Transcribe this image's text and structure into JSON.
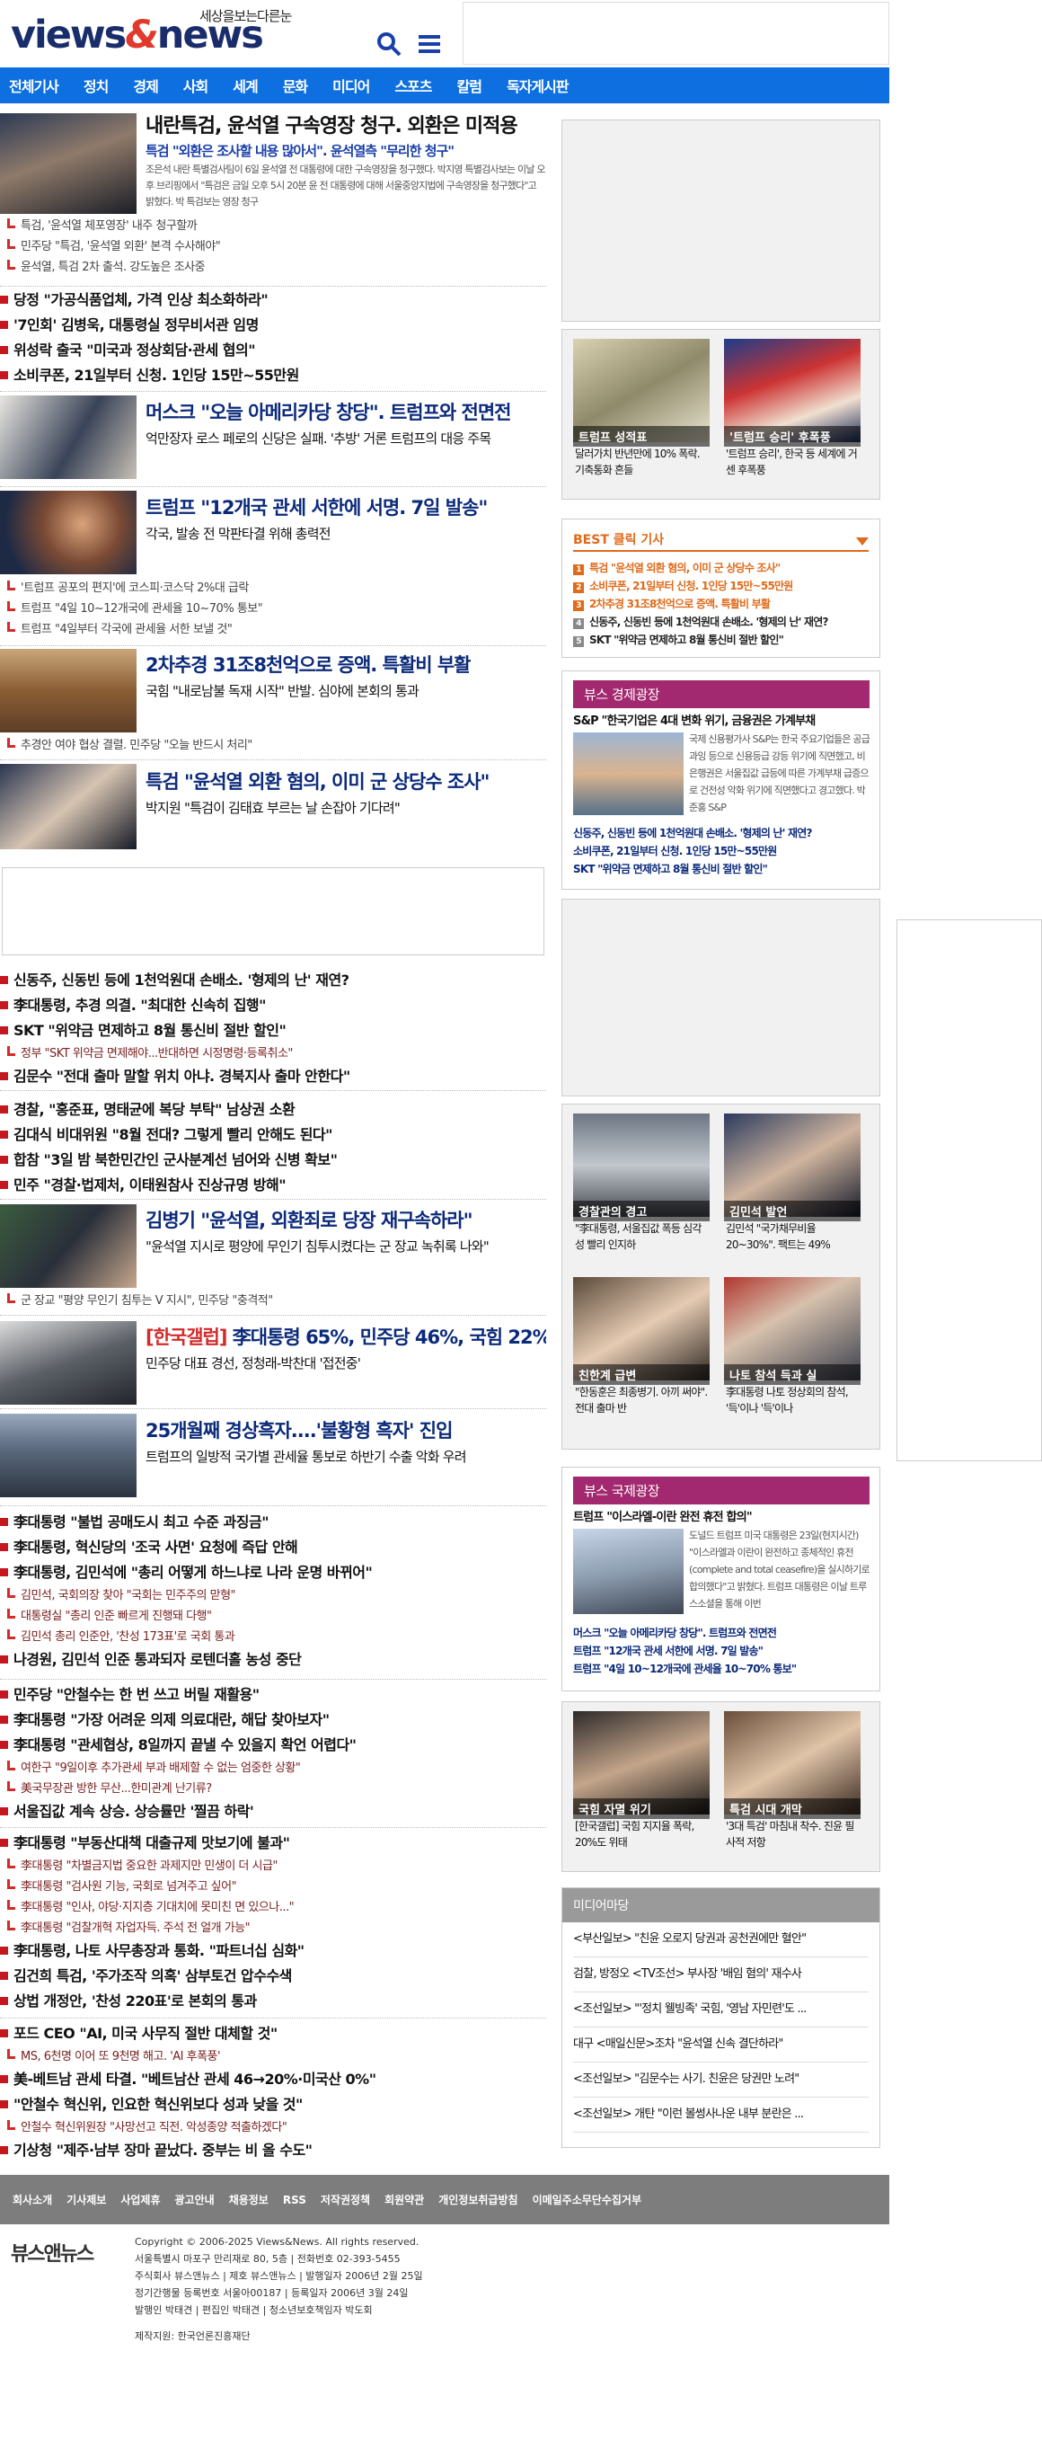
{
  "header": {
    "tagline": "세상을보는다른눈",
    "logo_views": "views",
    "logo_amp": "&",
    "logo_news": "news"
  },
  "nav": [
    "전체기사",
    "정치",
    "경제",
    "사회",
    "세계",
    "문화",
    "미디어",
    "스포츠",
    "칼럼",
    "독자게시판"
  ],
  "lead": {
    "title": "내란특검, 윤석열 구속영장 청구. 외환은 미적용",
    "subtitle": "특검 \"외환은 조사할 내용 많아서\". 윤석열측 \"무리한 청구\"",
    "body": "조은석 내란 특별검사팀이 6일 윤석열 전 대통령에 대한 구속영장을 청구했다. 박지영 특별검사보는 이날 오후 브리핑에서 \"특검은 금일 오후 5시 20분 윤 전 대통령에 대해 서울중앙지법에 구속영장을 청구했다\"고 밝혔다. 박 특검보는 영장 청구",
    "related": [
      "특검, '윤석열 체포영장' 내주 청구할까",
      "민주당 \"특검, '윤석열 외환' 본격 수사해야\"",
      "윤석열, 특검 2차 출석. 강도높은 조사중"
    ]
  },
  "list1": [
    "당정 \"가공식품업체, 가격 인상 최소화하라\"",
    "'7인회' 김병욱, 대통령실 정무비서관 임명",
    "위성락 출국 \"미국과 정상회담·관세 협의\"",
    "소비쿠폰, 21일부터 신청. 1인당 15만~55만원"
  ],
  "feature1": {
    "title": "머스크 \"오늘 아메리카당 창당\". 트럼프와 전면전",
    "sub": "억만장자 로스 페로의 신당은 실패. '추방' 거론 트럼프의 대응 주목"
  },
  "feature2": {
    "title": "트럼프 \"12개국 관세 서한에 서명. 7일 발송\"",
    "sub": "각국, 발송 전 막판타결 위해 총력전",
    "related": [
      "'트럼프 공포의 편지'에 코스피·코스닥 2%대 급락",
      "트럼프 \"4일 10~12개국에 관세율 10~70% 통보\"",
      "트럼프 \"4일부터 각국에 관세율 서한 보낼 것\""
    ]
  },
  "feature3": {
    "title": "2차추경 31조8천억으로 증액. 특활비 부활",
    "sub": "국힘 \"내로남불 독재 시작\" 반발. 심야에 본회의 통과",
    "related": [
      "추경안 여야 협상 결렬. 민주당 \"오늘 반드시 처리\""
    ]
  },
  "feature4": {
    "title": "특검 \"윤석열 외환 혐의, 이미 군 상당수 조사\"",
    "sub": "박지원 \"특검이 김태효 부르는 날 손잡아 기다려\""
  },
  "list2": [
    {
      "t": "신동주, 신동빈 등에 1천억원대 손배소. '형제의 난' 재연?"
    },
    {
      "t": "李대통령, 추경 의결. \"최대한 신속히 집행\""
    },
    {
      "t": "SKT \"위약금 면제하고 8월 통신비 절반 할인\"",
      "r": "정부 \"SKT 위약금 면제해야...반대하면 시정명령·등록취소\""
    },
    {
      "t": "김문수 \"전대 출마 말할 위치 아냐. 경북지사 출마 안한다\""
    }
  ],
  "list3": [
    "경찰, \"홍준표, 명태균에 복당 부탁\" 남상권 소환",
    "김대식 비대위원 \"8월 전대? 그렇게 빨리 안해도 된다\"",
    "합참 \"3일 밤 북한민간인 군사분계선 넘어와 신병 확보\"",
    "민주 \"경찰·법제처, 이태원참사 진상규명 방해\""
  ],
  "feature5": {
    "title": "김병기 \"윤석열, 외환죄로 당장 재구속하라\"",
    "sub": "\"윤석열 지시로 평양에 무인기 침투시켰다는 군 장교 녹취록 나와\"",
    "related": [
      "군 장교 \"평양 무인기 침투는 V 지시\", 민주당 \"충격적\""
    ]
  },
  "feature6": {
    "tag": "[한국갤럽]",
    "title": "李대통령 65%, 민주당 46%, 국힘 22%",
    "sub": "민주당 대표 경선, 정청래-박찬대 '접전중'"
  },
  "feature7": {
    "title": "25개월째 경상흑자....'불황형 흑자' 진입",
    "sub": "트럼프의 일방적 국가별 관세율 통보로 하반기 수출 악화 우려"
  },
  "list4": [
    {
      "t": "李대통령 \"불법 공매도시 최고 수준 과징금\""
    },
    {
      "t": "李대통령, 혁신당의 '조국 사면' 요청에 즉답 안해"
    },
    {
      "t": "李대통령, 김민석에 \"총리 어떻게 하느냐로 나라 운명 바뀌어\"",
      "r": [
        "김민석, 국회의장 찾아 \"국회는 민주주의 맏형\"",
        "대통령실 \"총리 인준 빠르게 진행돼 다행\"",
        "김민석 총리 인준안, '찬성 173표'로 국회 통과"
      ]
    },
    {
      "t": "나경원, 김민석 인준 통과되자 로텐더홀 농성 중단"
    }
  ],
  "list5": [
    {
      "t": "민주당 \"안철수는 한 번 쓰고 버릴 재활용\""
    },
    {
      "t": "李대통령 \"가장 어려운 의제 의료대란, 해답 찾아보자\""
    },
    {
      "t": "李대통령 \"관세협상, 8일까지 끝낼 수 있을지 확언 어렵다\"",
      "r": [
        "여한구 \"9일이후 추가관세 부과 배제할 수 없는 엄중한 상황\"",
        "美국무장관 방한 무산...한미관계 난기류?"
      ]
    },
    {
      "t": "서울집값 계속 상승. 상승률만 '찔끔 하락'"
    }
  ],
  "list6": [
    {
      "t": "李대통령 \"부동산대책 대출규제 맛보기에 불과\"",
      "r": [
        "李대통령 \"차별금지법 중요한 과제지만 민생이 더 시급\"",
        "李대통령 \"검사원 기능, 국회로 넘겨주고 싶어\"",
        "李대통령 \"인사, 야당·지지층 기대치에 못미친 면 있으나...\"",
        "李대통령 \"검찰개혁 자업자득. 주석 전 얼개 가능\""
      ]
    },
    {
      "t": "李대통령, 나토 사무총장과 통화. \"파트너십 심화\""
    },
    {
      "t": "김건희 특검, '주가조작 의혹' 삼부토건 압수수색"
    },
    {
      "t": "상법 개정안, '찬성 220표'로 본회의 통과"
    }
  ],
  "list7": [
    {
      "t": "포드 CEO \"AI, 미국 사무직 절반 대체할 것\"",
      "r": [
        "MS, 6천명 이어 또 9천명 해고. 'AI 후폭풍'"
      ]
    },
    {
      "t": "美-베트남 관세 타결. \"베트남산 관세 46→20%·미국산 0%\""
    },
    {
      "t": "\"안철수 혁신위, 인요한 혁신위보다 성과 낮을 것\"",
      "r": [
        "안철수 혁신위원장 \"사망선고 직전. 악성종양 적출하겠다\""
      ]
    },
    {
      "t": "기상청 \"제주·남부 장마 끝났다. 중부는 비 올 수도\""
    }
  ],
  "side1": [
    {
      "cap": "트럼프 성적표",
      "txt": "달러가치 반년만에 10% 폭락. 기축통화 흔들"
    },
    {
      "cap": "'트럼프 승리' 후폭풍",
      "txt": "'트럼프 승리', 한국 등 세계에 거센 후폭풍"
    }
  ],
  "best": {
    "title": "BEST 클릭 기사",
    "items": [
      "특검 \"윤석열 외환 혐의, 이미 군 상당수 조사\"",
      "소비쿠폰, 21일부터 신청. 1인당 15만~55만원",
      "2차추경 31조8천억으로 증액. 특활비 부활",
      "신동주, 신동빈 등에 1천억원대 손배소. '형제의 난' 재연?",
      "SKT \"위약금 면제하고 8월 통신비 절반 할인\""
    ],
    "nums": [
      "1",
      "2",
      "3",
      "4",
      "5"
    ]
  },
  "econ": {
    "title": "뷰스 경제광장",
    "headline": "S&P \"한국기업은 4대 변화 위기, 금융권은 가계부채",
    "body": "국제 신용평가사 S&P는 한국 주요기업들은 공급과잉 등으로 신용등급 강등 위기에 직면했고, 비은행권은 서울집값 급등에 따른 가계부채 급증으로 건전성 악화 위기에 직면했다고 경고했다. 박준홍 S&P",
    "links": [
      "신동주, 신동빈 등에 1천억원대 손배소. '형제의 난' 재연?",
      "소비쿠폰, 21일부터 신청. 1인당 15만~55만원",
      "SKT \"위약금 면제하고 8월 통신비 절반 할인\""
    ]
  },
  "side2": [
    {
      "cap": "경찰관의 경고",
      "txt": "\"李대통령, 서울집값 폭등 심각성 빨리 인지하"
    },
    {
      "cap": "김민석 발언",
      "txt": "김민석 \"국가채무비율 20~30%\". 팩트는 49%"
    },
    {
      "cap": "친한계 급변",
      "txt": "\"한동훈은 최종병기. 아끼 써야\". 전대 출마 반"
    },
    {
      "cap": "나토 참석 득과 실",
      "txt": "李대통령 나토 정상회의 참석, '득'이나 '득'이나"
    }
  ],
  "intl": {
    "title": "뷰스 국제광장",
    "headline": "트럼프 \"이스라엘-이란 완전 휴전 합의\"",
    "body": "도널드 트럼프 미국 대통령은 23일(현지시간) \"이스라엘과 이란이 완전하고 종체적인 휴전(complete and total ceasefire)을 실시하기로 합의했다\"고 밝혔다. 트럼프 대통령은 이날 트루스소셜을 통해 이번",
    "links": [
      "머스크 \"오늘 아메리카당 창당\". 트럼프와 전면전",
      "트럼프 \"12개국 관세 서한에 서명. 7일 발송\"",
      "트럼프 \"4일 10~12개국에 관세율 10~70% 통보\""
    ]
  },
  "side3": [
    {
      "cap": "국힘 자멸 위기",
      "txt": "[한국갤럽] 국힘 지지율 폭락, 20%도 위태"
    },
    {
      "cap": "특검 시대 개막",
      "txt": "'3대 특검' 마침내 착수. 진윤 필사적 저항"
    }
  ],
  "media": {
    "title": "미디어마당",
    "items": [
      "<부산일보> \"친윤 오로지 당권과 공천권에만 혈안\"",
      "검찰, 방정오 <TV조선> 부사장 '배임 혐의' 재수사",
      "<조선일보> \"'정치 웰빙족' 국힘, '영남 자민련'도 ...",
      "대구 <매일신문>조차 \"윤석열 신속 결단하라\"",
      "<조선일보> \"김문수는 사기. 친윤은 당권만 노려\"",
      "<조선일보> 개탄 \"이런 볼썽사나운 내부 분란은 ..."
    ]
  },
  "footer": {
    "links": [
      "회사소개",
      "기사제보",
      "사업제휴",
      "광고안내",
      "채용정보",
      "RSS",
      "저작권정책",
      "회원약관",
      "개인정보취급방침",
      "이메일주소무단수집거부"
    ],
    "logo": "뷰스앤뉴스",
    "copy": [
      "Copyright © 2006-2025 Views&News. All rights reserved.",
      "서울특별시 마포구 만리재로 80, 5층 | 전화번호 02-393-5455",
      "주식회사 뷰스앤뉴스 | 제호 뷰스앤뉴스 | 발행일자 2006년 2월 25일",
      "정기간행물 등록번호 서울아00187 | 등록일자 2006년 3월 24일",
      "발행인 박태견 | 편집인 박태견 | 청소년보호책임자 박도회"
    ],
    "support": "제작지원: 한국언론진흥재단"
  }
}
